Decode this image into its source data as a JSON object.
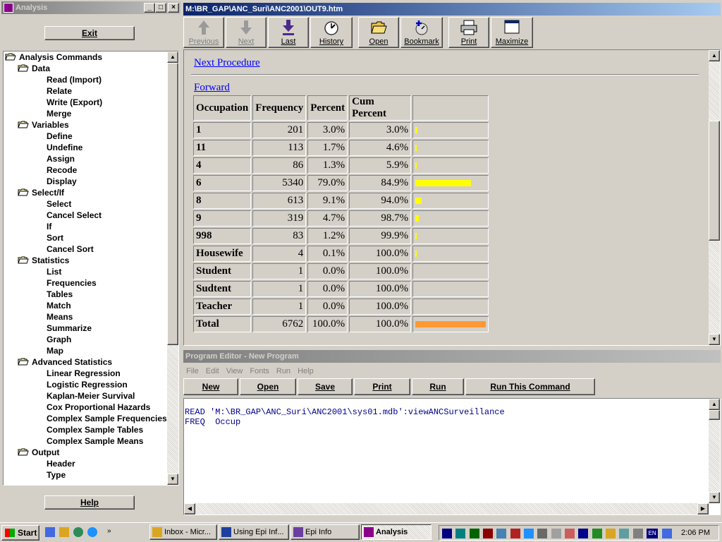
{
  "analysis_window": {
    "title": "Analysis",
    "exit_label": "Exit",
    "help_label": "Help",
    "tree": [
      {
        "label": "Analysis Commands",
        "level": 0,
        "folder": true
      },
      {
        "label": "Data",
        "level": 1,
        "folder": true
      },
      {
        "label": "Read (Import)",
        "level": 2
      },
      {
        "label": "Relate",
        "level": 2
      },
      {
        "label": "Write (Export)",
        "level": 2
      },
      {
        "label": "Merge",
        "level": 2
      },
      {
        "label": "Variables",
        "level": 1,
        "folder": true
      },
      {
        "label": "Define",
        "level": 2
      },
      {
        "label": "Undefine",
        "level": 2
      },
      {
        "label": "Assign",
        "level": 2
      },
      {
        "label": "Recode",
        "level": 2
      },
      {
        "label": "Display",
        "level": 2
      },
      {
        "label": "Select/If",
        "level": 1,
        "folder": true
      },
      {
        "label": "Select",
        "level": 2
      },
      {
        "label": "Cancel Select",
        "level": 2
      },
      {
        "label": "If",
        "level": 2
      },
      {
        "label": "Sort",
        "level": 2
      },
      {
        "label": "Cancel Sort",
        "level": 2
      },
      {
        "label": "Statistics",
        "level": 1,
        "folder": true
      },
      {
        "label": "List",
        "level": 2
      },
      {
        "label": "Frequencies",
        "level": 2
      },
      {
        "label": "Tables",
        "level": 2
      },
      {
        "label": "Match",
        "level": 2
      },
      {
        "label": "Means",
        "level": 2
      },
      {
        "label": "Summarize",
        "level": 2
      },
      {
        "label": "Graph",
        "level": 2
      },
      {
        "label": "Map",
        "level": 2
      },
      {
        "label": "Advanced Statistics",
        "level": 1,
        "folder": true
      },
      {
        "label": "Linear Regression",
        "level": 2
      },
      {
        "label": "Logistic Regression",
        "level": 2
      },
      {
        "label": "Kaplan-Meier Survival",
        "level": 2
      },
      {
        "label": "Cox Proportional Hazards",
        "level": 2
      },
      {
        "label": "Complex Sample Frequencies",
        "level": 2
      },
      {
        "label": "Complex Sample Tables",
        "level": 2
      },
      {
        "label": "Complex Sample Means",
        "level": 2
      },
      {
        "label": "Output",
        "level": 1,
        "folder": true
      },
      {
        "label": "Header",
        "level": 2
      },
      {
        "label": "Type",
        "level": 2
      }
    ]
  },
  "output_window": {
    "title": "M:\\BR_GAP\\ANC_Suri\\ANC2001\\OUT9.htm",
    "toolbar": [
      {
        "label": "Previous",
        "icon": "up-arrow-icon",
        "disabled": true
      },
      {
        "label": "Next",
        "icon": "down-arrow-icon",
        "disabled": true
      },
      {
        "label": "Last",
        "icon": "last-arrow-icon",
        "disabled": false
      },
      {
        "label": "History",
        "icon": "history-icon",
        "disabled": false
      },
      {
        "label": "Open",
        "icon": "open-folder-icon",
        "disabled": false
      },
      {
        "label": "Bookmark",
        "icon": "bookmark-icon",
        "disabled": false
      },
      {
        "label": "Print",
        "icon": "printer-icon",
        "disabled": false
      },
      {
        "label": "Maximize",
        "icon": "maximize-icon",
        "disabled": false
      }
    ],
    "next_procedure_link": "Next Procedure",
    "forward_link": "Forward",
    "table": {
      "headers": [
        "Occupation",
        "Frequency",
        "Percent",
        "Cum Percent"
      ],
      "rows": [
        {
          "label": "1",
          "freq": "201",
          "pct": "3.0%",
          "cum": "3.0%",
          "bar": 3.0
        },
        {
          "label": "11",
          "freq": "113",
          "pct": "1.7%",
          "cum": "4.6%",
          "bar": 1.7
        },
        {
          "label": "4",
          "freq": "86",
          "pct": "1.3%",
          "cum": "5.9%",
          "bar": 1.3
        },
        {
          "label": "6",
          "freq": "5340",
          "pct": "79.0%",
          "cum": "84.9%",
          "bar": 79.0
        },
        {
          "label": "8",
          "freq": "613",
          "pct": "9.1%",
          "cum": "94.0%",
          "bar": 9.1
        },
        {
          "label": "9",
          "freq": "319",
          "pct": "4.7%",
          "cum": "98.7%",
          "bar": 4.7
        },
        {
          "label": "998",
          "freq": "83",
          "pct": "1.2%",
          "cum": "99.9%",
          "bar": 1.2
        },
        {
          "label": "Housewife",
          "freq": "4",
          "pct": "0.1%",
          "cum": "100.0%",
          "bar": 0.1
        },
        {
          "label": "Student",
          "freq": "1",
          "pct": "0.0%",
          "cum": "100.0%",
          "bar": 0
        },
        {
          "label": "Sudtent",
          "freq": "1",
          "pct": "0.0%",
          "cum": "100.0%",
          "bar": 0
        },
        {
          "label": "Teacher",
          "freq": "1",
          "pct": "0.0%",
          "cum": "100.0%",
          "bar": 0
        }
      ],
      "total": {
        "label": "Total",
        "freq": "6762",
        "pct": "100.0%",
        "cum": "100.0%",
        "bar": 100
      }
    },
    "bar_color": "#ffff00",
    "total_bar_color": "#ff9933"
  },
  "program_editor": {
    "title": "Program Editor - New Program",
    "menu": [
      "File",
      "Edit",
      "View",
      "Fonts",
      "Run",
      "Help"
    ],
    "buttons": [
      "New",
      "Open",
      "Save",
      "Print",
      "Run",
      "Run This Command"
    ],
    "code_lines": [
      "READ 'M:\\BR_GAP\\ANC_Suri\\ANC2001\\sys01.mdb':viewANCSurveillance",
      "FREQ  Occup"
    ]
  },
  "taskbar": {
    "start_label": "Start",
    "tasks": [
      {
        "label": "Inbox - Micr...",
        "active": false
      },
      {
        "label": "Using Epi Inf...",
        "active": false
      },
      {
        "label": "Epi Info",
        "active": false
      },
      {
        "label": "Analysis",
        "active": true
      }
    ],
    "clock": "2:06 PM",
    "language": "EN"
  }
}
